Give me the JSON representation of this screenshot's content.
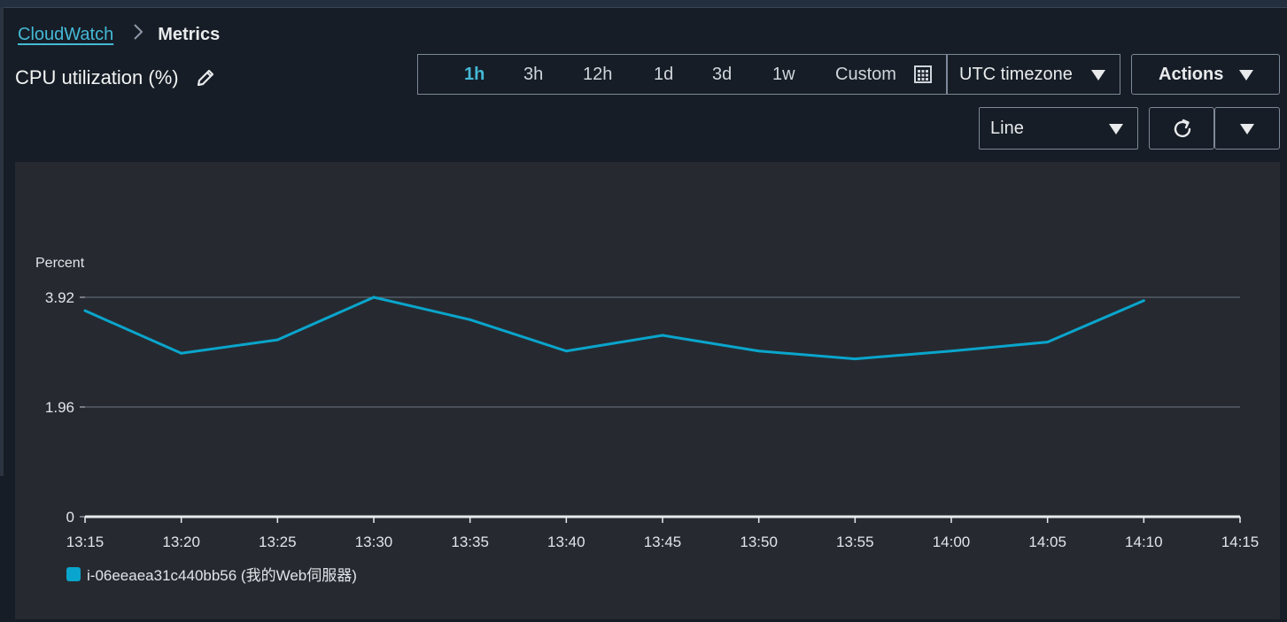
{
  "breadcrumb": {
    "root": "CloudWatch",
    "current": "Metrics"
  },
  "title": "CPU utilization (%)",
  "range": {
    "options": [
      "1h",
      "3h",
      "12h",
      "1d",
      "3d",
      "1w",
      "Custom"
    ],
    "active": "1h"
  },
  "timezone": {
    "label": "UTC timezone"
  },
  "actions": {
    "label": "Actions"
  },
  "chart_type_select": {
    "label": "Line"
  },
  "icons": {
    "edit": "pencil-icon",
    "calendar": "calendar-icon",
    "refresh": "refresh-icon",
    "dropdown": "chevron-down-icon"
  },
  "colors": {
    "accent": "#44b9d6",
    "series": "#0aa5cc",
    "background": "#161d26",
    "panel": "#262a30"
  },
  "chart_data": {
    "type": "line",
    "ylabel": "Percent",
    "yticks": [
      "3.92",
      "1.96",
      "0"
    ],
    "ylim": [
      0,
      4.25
    ],
    "grid": true,
    "legend_position": "bottom-left",
    "x_ticks": [
      "13:15",
      "13:20",
      "13:25",
      "13:30",
      "13:35",
      "13:40",
      "13:45",
      "13:50",
      "13:55",
      "14:00",
      "14:05",
      "14:10",
      "14:15"
    ],
    "series": [
      {
        "name": "i-06eeaea31c440bb56 (我的Web伺服器)",
        "x": [
          "13:15",
          "13:20",
          "13:25",
          "13:30",
          "13:35",
          "13:40",
          "13:45",
          "13:50",
          "13:55",
          "14:00",
          "14:05",
          "14:10"
        ],
        "values": [
          3.68,
          2.92,
          3.16,
          3.92,
          3.52,
          2.96,
          3.24,
          2.96,
          2.82,
          2.96,
          3.12,
          3.86
        ]
      }
    ]
  }
}
